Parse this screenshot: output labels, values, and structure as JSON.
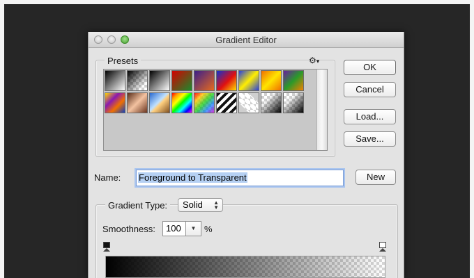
{
  "window": {
    "title": "Gradient Editor"
  },
  "presets": {
    "label": "Presets",
    "menu_icon": "gear-icon",
    "swatches": [
      {
        "name": "foreground-to-background"
      },
      {
        "name": "foreground-to-transparent"
      },
      {
        "name": "black-white"
      },
      {
        "name": "red-green"
      },
      {
        "name": "violet-orange"
      },
      {
        "name": "blue-red-yellow"
      },
      {
        "name": "blue-yellow-blue"
      },
      {
        "name": "orange-yellow-orange"
      },
      {
        "name": "violet-green-orange"
      },
      {
        "name": "yellow-violet-orange-blue"
      },
      {
        "name": "copper"
      },
      {
        "name": "chrome"
      },
      {
        "name": "spectrum"
      },
      {
        "name": "transparent-rainbow"
      },
      {
        "name": "transparent-stripes"
      },
      {
        "name": "neutral-density"
      },
      {
        "name": "black-transparent-1"
      },
      {
        "name": "black-transparent-2"
      }
    ]
  },
  "buttons": {
    "ok": "OK",
    "cancel": "Cancel",
    "load": "Load...",
    "save": "Save...",
    "new": "New"
  },
  "name": {
    "label": "Name:",
    "value": "Foreground to Transparent"
  },
  "gradient_type": {
    "label": "Gradient Type:",
    "value": "Solid"
  },
  "smoothness": {
    "label": "Smoothness:",
    "value": "100",
    "unit": "%"
  }
}
